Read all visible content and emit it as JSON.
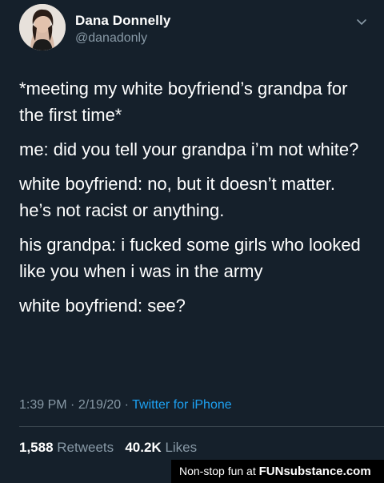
{
  "tweet": {
    "author": {
      "display_name": "Dana Donnelly",
      "handle": "@danadonly",
      "avatar_icon": "profile-photo"
    },
    "menu_icon": "chevron-down-icon",
    "paragraphs": [
      "*meeting my white boyfriend’s grandpa for the first time*",
      "me: did you tell your grandpa i’m not white?",
      "white boyfriend: no, but it doesn’t matter. he’s not racist or anything.",
      "his grandpa: i fucked some girls who looked like you when i was in the army",
      "white boyfriend: see?"
    ],
    "time": "1:39 PM",
    "date": "2/19/20",
    "separator": " · ",
    "date_separator": " · ",
    "source": "Twitter for iPhone",
    "retweets_count": "1,588",
    "retweets_label": "Retweets",
    "likes_count": "40.2K",
    "likes_label": "Likes"
  },
  "watermark": {
    "prefix": "Non-stop fun at ",
    "brand": "FUNsubstance.com"
  },
  "colors": {
    "background": "#15202b",
    "primary_text": "#ffffff",
    "secondary_text": "#8899a6",
    "link": "#1da1f2",
    "divider": "#38444d"
  }
}
